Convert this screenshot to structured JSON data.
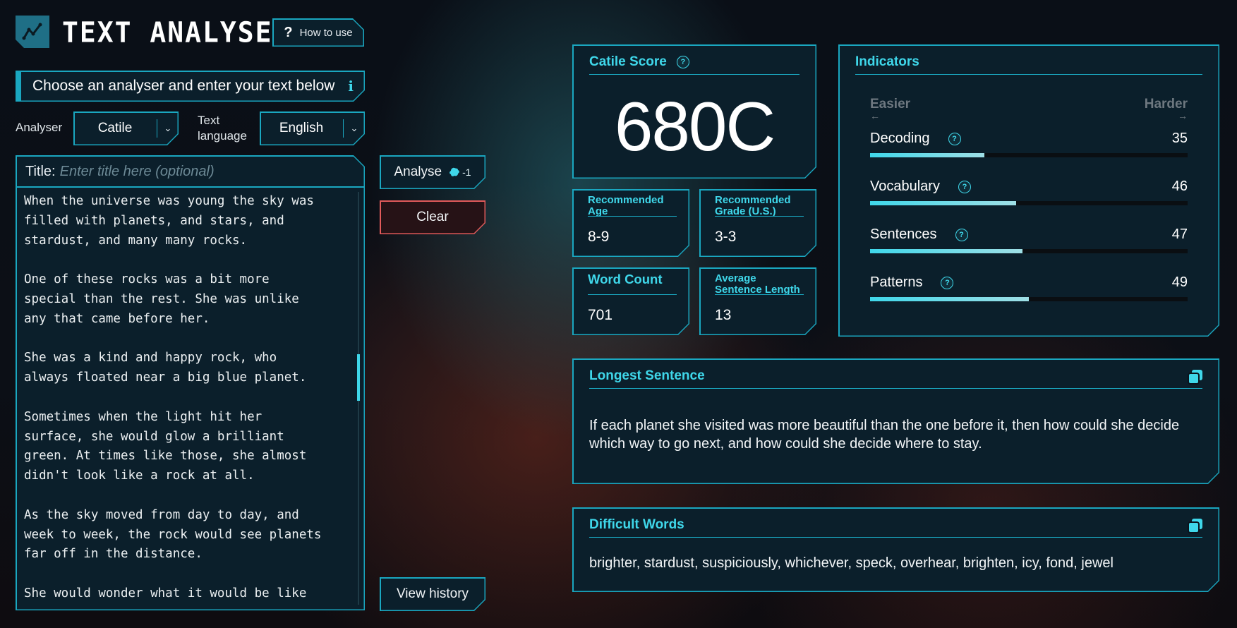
{
  "header": {
    "app_title": "TEXT ANALYSER",
    "how_to_use_label": "How to use"
  },
  "banner": {
    "text": "Choose an analyser and enter your text below",
    "info_glyph": "i"
  },
  "controls": {
    "analyser_label": "Analyser",
    "analyser_value": "Catile",
    "language_label_1": "Text",
    "language_label_2": "language",
    "language_value": "English"
  },
  "editor": {
    "title_label": "Title:",
    "title_placeholder": "Enter title here (optional)",
    "text": "When the universe was young the sky was\nfilled with planets, and stars, and\nstardust, and many many rocks.\n\nOne of these rocks was a bit more\nspecial than the rest. She was unlike\nany that came before her.\n\nShe was a kind and happy rock, who\nalways floated near a big blue planet.\n\nSometimes when the light hit her\nsurface, she would glow a brilliant\ngreen. At times like those, she almost\ndidn't look like a rock at all.\n\nAs the sky moved from day to day, and\nweek to week, the rock would see planets\nfar off in the distance.\n\nShe would wonder what it would be like"
  },
  "actions": {
    "analyse_label": "Analyse",
    "analyse_cost": "-1",
    "clear_label": "Clear",
    "history_label": "View history"
  },
  "score": {
    "title": "Catile Score",
    "value": "680C"
  },
  "stats": {
    "age_title": "Recommended Age",
    "age_value": "8-9",
    "grade_title": "Recommended Grade (U.S.)",
    "grade_value": "3-3",
    "word_count_title": "Word Count",
    "word_count_value": "701",
    "avg_sentence_title": "Average Sentence Length",
    "avg_sentence_value": "13"
  },
  "indicators": {
    "title": "Indicators",
    "easier_label": "Easier",
    "harder_label": "Harder",
    "items": [
      {
        "label": "Decoding",
        "value": "35",
        "level": 0.36
      },
      {
        "label": "Vocabulary",
        "value": "46",
        "level": 0.46
      },
      {
        "label": "Sentences",
        "value": "47",
        "level": 0.48
      },
      {
        "label": "Patterns",
        "value": "49",
        "level": 0.5
      }
    ]
  },
  "longest": {
    "title": "Longest Sentence",
    "text": "If each planet she visited was more beautiful than the one before it, then how could she decide which way to go next, and how could she decide where to stay."
  },
  "difficult": {
    "title": "Difficult Words",
    "text": "brighter, stardust, suspiciously, whichever, speck, overhear, brighten, icy, fond, jewel"
  },
  "theme": {
    "accent": "#1aa7c0",
    "highlight": "#3fd7ea",
    "danger": "#e25a5a"
  },
  "icons": {
    "logo": "line-chart-icon",
    "help": "question-icon",
    "copy": "copy-icon",
    "cost": "splat-icon"
  }
}
